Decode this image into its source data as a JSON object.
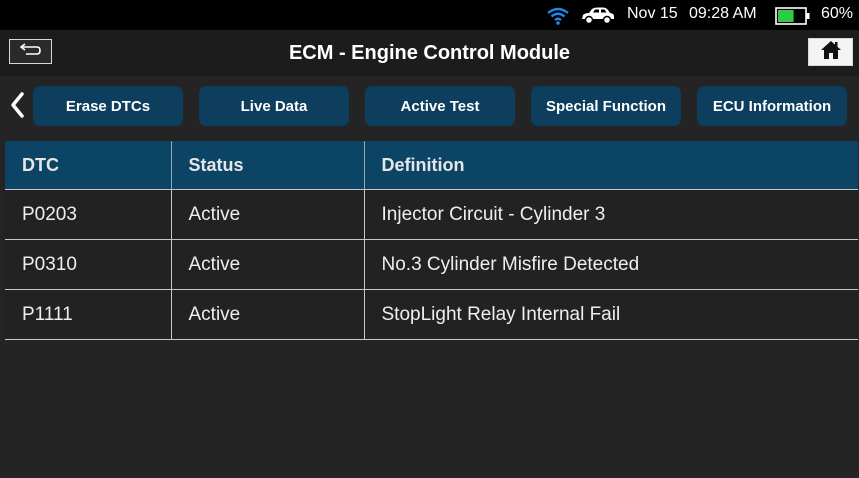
{
  "status_bar": {
    "date": "Nov 15",
    "time": "09:28 AM",
    "battery_percent": "60%",
    "battery_level": 0.6,
    "icons": [
      "wifi-icon",
      "car-icon",
      "battery-icon"
    ]
  },
  "header": {
    "title": "ECM - Engine Control Module",
    "back_icon": "return-arrow-icon",
    "home_icon": "home-icon"
  },
  "toolbar": {
    "scroll_left_icon": "chevron-left-icon",
    "buttons": [
      {
        "label": "Erase DTCs"
      },
      {
        "label": "Live Data"
      },
      {
        "label": "Active Test"
      },
      {
        "label": "Special Function"
      },
      {
        "label": "ECU Information"
      }
    ]
  },
  "dtc_table": {
    "columns": [
      "DTC",
      "Status",
      "Definition"
    ],
    "rows": [
      {
        "dtc": "P0203",
        "status": "Active",
        "definition": "Injector Circuit - Cylinder 3"
      },
      {
        "dtc": "P0310",
        "status": "Active",
        "definition": "No.3 Cylinder Misfire Detected"
      },
      {
        "dtc": "P1111",
        "status": "Active",
        "definition": "StopLight Relay Internal Fail"
      }
    ]
  },
  "colors": {
    "background": "#242424",
    "header_bar": "#1c1c1c",
    "button_bg": "#0e3e5e",
    "table_header": "#0c4466",
    "wifi": "#1e88e5",
    "battery_fill": "#2ecc40"
  }
}
